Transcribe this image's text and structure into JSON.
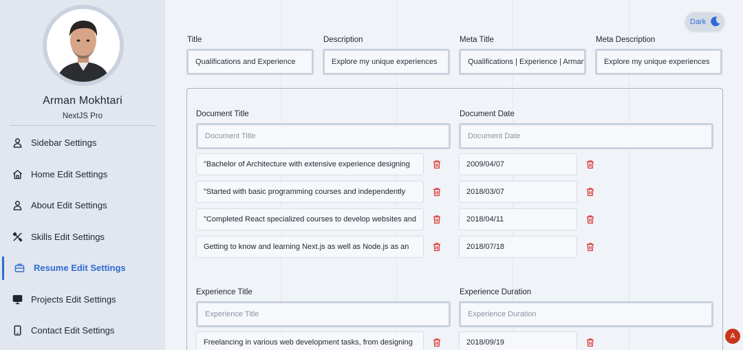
{
  "profile": {
    "name": "Arman Mokhtari",
    "role": "NextJS Pro"
  },
  "nav": [
    {
      "label": "Sidebar Settings",
      "icon": "user-icon"
    },
    {
      "label": "Home Edit Settings",
      "icon": "home-icon"
    },
    {
      "label": "About Edit Settings",
      "icon": "user-icon"
    },
    {
      "label": "Skills Edit Settings",
      "icon": "tools-icon"
    },
    {
      "label": "Resume Edit Settings",
      "icon": "briefcase-icon",
      "active": true
    },
    {
      "label": "Projects Edit Settings",
      "icon": "monitor-icon"
    },
    {
      "label": "Contact Edit Settings",
      "icon": "phone-icon"
    }
  ],
  "theme_toggle": {
    "label": "Dark"
  },
  "meta": {
    "title_label": "Title",
    "title_value": "Qualifications and Experience",
    "description_label": "Description",
    "description_value": "Explore my unique experiences",
    "meta_title_label": "Meta Title",
    "meta_title_value": "Qualifications | Experience | Arman",
    "meta_description_label": "Meta Description",
    "meta_description_value": "Explore my unique experiences"
  },
  "documents": {
    "title_label": "Document Title",
    "title_placeholder": "Document Title",
    "date_label": "Document Date",
    "date_placeholder": "Document Date",
    "rows": [
      {
        "title": "\"Bachelor of Architecture with extensive experience designing",
        "date": "2009/04/07"
      },
      {
        "title": "\"Started with basic programming courses and independently",
        "date": "2018/03/07"
      },
      {
        "title": "\"Completed React specialized courses to develop websites and",
        "date": "2018/04/11"
      },
      {
        "title": "Getting to know and learning Next.js as well as Node.js as an",
        "date": "2018/07/18"
      }
    ]
  },
  "experience": {
    "title_label": "Experience Title",
    "title_placeholder": "Experience Title",
    "duration_label": "Experience Duration",
    "duration_placeholder": "Experience Duration",
    "rows": [
      {
        "title": "Freelancing in various web development tasks, from designing",
        "duration": "2018/09/19"
      }
    ]
  },
  "fab": {
    "label": "A"
  },
  "colors": {
    "accent": "#2e6bd6",
    "danger": "#d93a32",
    "sidebar_bg": "#e2e7ef",
    "page_bg": "#f0f3f8"
  }
}
